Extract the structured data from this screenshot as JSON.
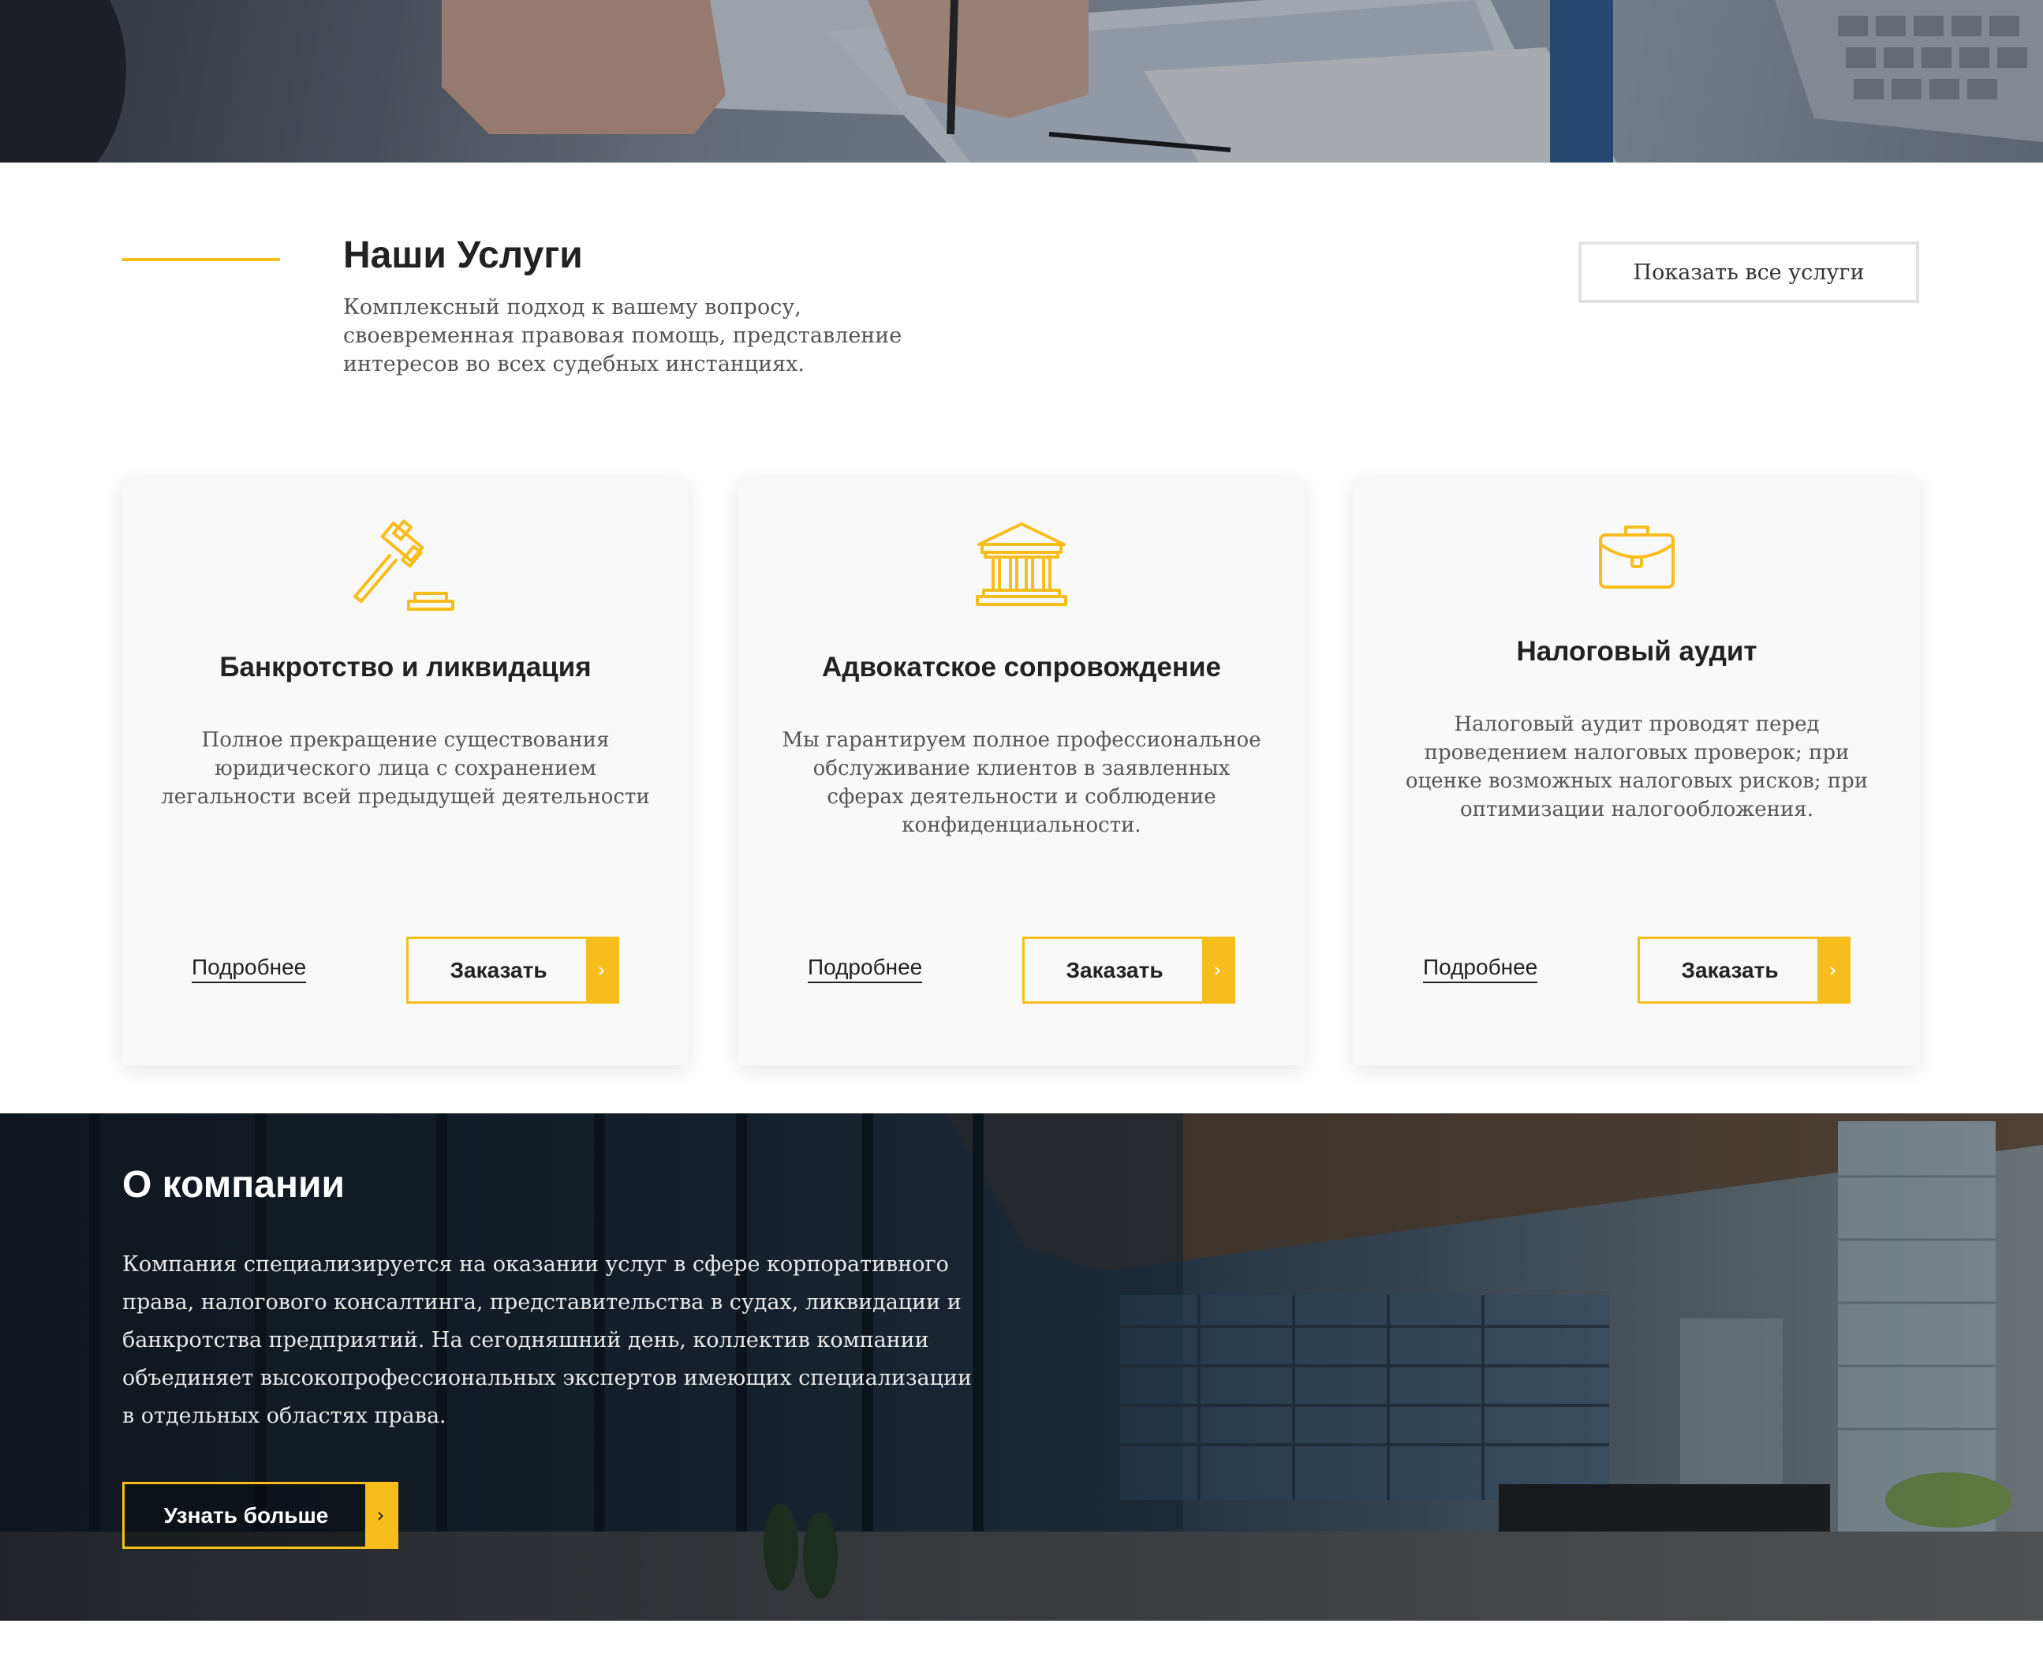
{
  "colors": {
    "accent": "#f7bd1c",
    "card_background": "#f9f9f9",
    "text_dark": "#222222",
    "text_muted": "#555555"
  },
  "hero": {
    "image": "photo-of-hands-with-pen-over-financial-documents-and-keyboard"
  },
  "services": {
    "title": "Наши Услуги",
    "subtitle": "Комплексный подход к вашему вопросу, своевременная правовая помощь, представление интересов во всех судебных инстанциях.",
    "show_all_label": "Показать все услуги",
    "cards": [
      {
        "icon": "gavel-icon",
        "title": "Банкротство и ликвидация",
        "text": "Полное прекращение существования юридического лица с сохранением легальности всей предыдущей деятельности",
        "more_label": "Подробнее",
        "order_label": "Заказать"
      },
      {
        "icon": "courthouse-icon",
        "title": "Адвокатское сопровождение",
        "text": "Мы гарантируем полное профессиональное обслуживание клиентов в заявленных сферах деятельности и соблюдение конфиденциальности.",
        "more_label": "Подробнее",
        "order_label": "Заказать"
      },
      {
        "icon": "briefcase-icon",
        "title": "Налоговый аудит",
        "text": "Налоговый аудит проводят перед проведением налоговых проверок; при оценке возможных налоговых рисков; при оптимизации налогообложения.",
        "more_label": "Подробнее",
        "order_label": "Заказать"
      }
    ]
  },
  "about": {
    "title": "О компании",
    "text": "Компания специализируется на оказании услуг в сфере корпоративного права, налогового консалтинга, представительства в судах, ликвидации и банкротства предприятий. На сегодняшний день, коллектив компании объединяет высокопрофессиональных экспертов имеющих специализации в отдельных областях права.",
    "button_label": "Узнать больше",
    "image": "photo-of-glass-office-building-exterior"
  },
  "icons": {
    "arrow": "chevron-right-icon"
  }
}
